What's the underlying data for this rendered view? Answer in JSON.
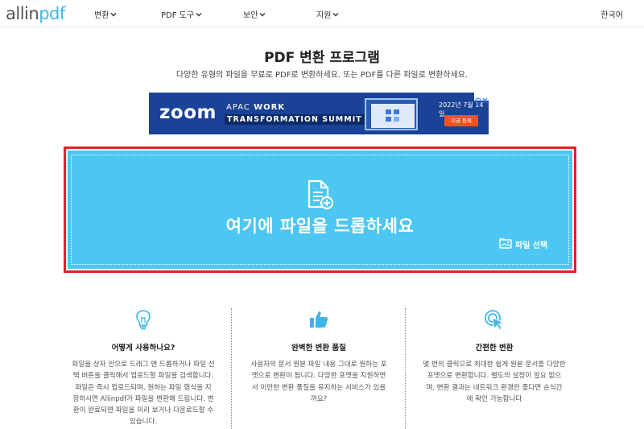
{
  "nav": {
    "logo_left": "allin",
    "logo_right": "pdf",
    "items": [
      "변환",
      "PDF 도구",
      "보안",
      "지원"
    ],
    "language": "한국어"
  },
  "heading": {
    "title": "PDF 변환 프로그램",
    "subtitle": "다양한 유형의 파일을 무료로 PDF로 변환하세요. 또는 PDF를 다른 파일로 변환하세요."
  },
  "ad": {
    "brand": "zoom",
    "line1_a": "APAC",
    "line1_b": "WORK",
    "line2": "TRANSFORMATION SUMMIT",
    "date": "2022년 7월 14일",
    "cta": "지금 등록"
  },
  "dropzone": {
    "text": "여기에 파일을 드롭하세요",
    "select_label": "파일 선택"
  },
  "features": [
    {
      "icon": "lightbulb-icon",
      "title": "어떻게 사용하나요?",
      "lines": [
        "파일을 상자 안으로 드래그 앤 드롭하거나 파일 선",
        "택 버튼을 클릭해서 업로드할 파일을 검색합니다.",
        "파일은 즉시 업로드되며, 원하는 파일 형식을 지",
        "정하시면 Allinpdf가 파일을 변환해 드립니다. 변",
        "환이 완료되면 파일을 미리 보거나 다운로드할 수",
        "있습니다."
      ]
    },
    {
      "icon": "thumbs-up-icon",
      "title": "완벽한 변환 품질",
      "lines": [
        "사용자의 문서 원본 파일 내용 그대로 원하는 포",
        "맷으로 변환이 됩니다. 다양한 포맷을 지원하면",
        "서 이만한 변환 품질을 유지하는 서비스가 있을",
        "까요?"
      ]
    },
    {
      "icon": "click-icon",
      "title": "간편한 변환",
      "lines": [
        "몇 번의 클릭으로 최대한 쉽게 원본 문서를 다양한",
        "포맷으로 변환합니다. 별도의 설정이 필요 없으",
        "며, 변환 결과는 네트워크 환경만 좋다면 순식간",
        "에 확인 가능합니다"
      ]
    }
  ],
  "colors": {
    "accent": "#4dc6f1",
    "highlight": "#e8202a",
    "ad_bg": "#1a4296"
  }
}
